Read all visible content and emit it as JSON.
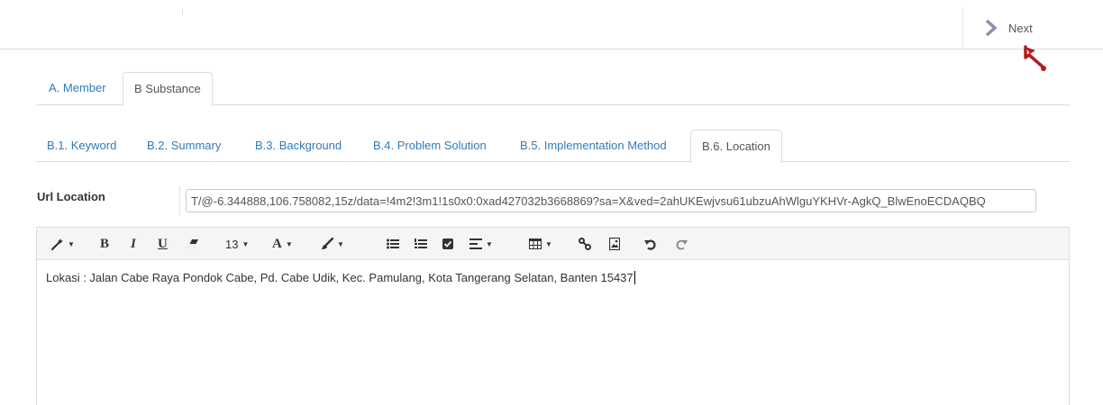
{
  "header": {
    "next_label": "Next"
  },
  "main_tabs": [
    {
      "label": "A. Member",
      "active": false
    },
    {
      "label": "B Substance",
      "active": true
    }
  ],
  "sub_tabs": [
    {
      "label": "B.1. Keyword",
      "active": false
    },
    {
      "label": "B.2. Summary",
      "active": false
    },
    {
      "label": "B.3. Background",
      "active": false
    },
    {
      "label": "B.4. Problem Solution",
      "active": false
    },
    {
      "label": "B.5. Implementation Method",
      "active": false
    },
    {
      "label": "B.6. Location",
      "active": true
    }
  ],
  "url_field": {
    "label": "Url Location",
    "value": "T/@-6.344888,106.758082,15z/data=!4m2!3m1!1s0x0:0xad427032b3668869?sa=X&ved=2ahUKEwjvsu61ubzuAhWlguYKHVr-AgkQ_BlwEnoECDAQBQ"
  },
  "toolbar": {
    "bold": "B",
    "italic": "I",
    "underline": "U",
    "font_size": "13",
    "font_color": "A"
  },
  "editor": {
    "content": "Lokasi : Jalan Cabe Raya Pondok Cabe, Pd. Cabe Udik, Kec. Pamulang, Kota Tangerang Selatan, Banten 15437"
  },
  "colors": {
    "link": "#337ab7",
    "pointer": "#b71c1c",
    "chevron": "#8f8fa8"
  }
}
